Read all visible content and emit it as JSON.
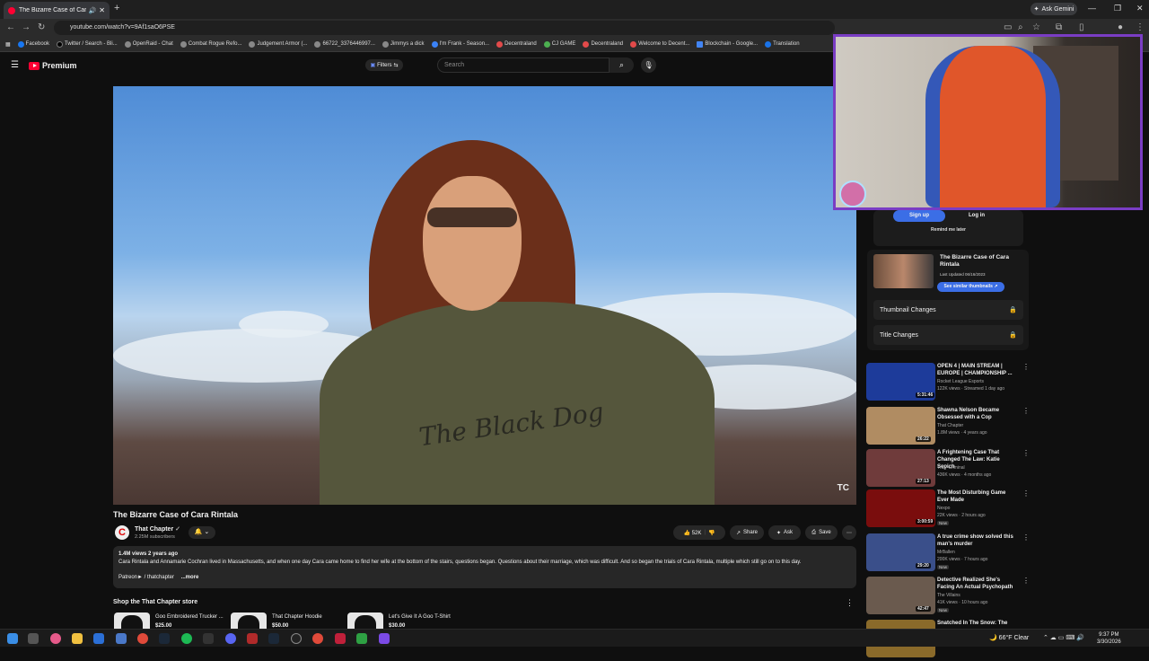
{
  "browser": {
    "tab_title": "The Bizarre Case of Cara Rintala",
    "new_tab": "+",
    "ask_gemini": "Ask Gemini",
    "url": "youtube.com/watch?v=9Af1saO6PSE",
    "bookmarks": [
      "Facebook",
      "Twitter / Search - Bli...",
      "OpenRaid - Chat",
      "Combat Rogue Refo...",
      "Judgement Armor (...",
      "66722_3376446997...",
      "Jimmys a dick",
      "I'm Frank - Season...",
      "Decentraland",
      "CJ GAME",
      "Decentraland",
      "Welcome to Decent...",
      "Blockchain - Google...",
      "Translation"
    ]
  },
  "youtube": {
    "logo_label": "Premium",
    "filters_label": "Filters",
    "search_placeholder": "Search"
  },
  "video": {
    "title": "The Bizarre Case of Cara Rintala",
    "hoodie_text": "The Black Dog",
    "watermark": "TC",
    "channel": {
      "avatar_letter": "C",
      "name": "That Chapter",
      "subscribers": "2.25M subscribers"
    },
    "likes": "52K",
    "share_label": "Share",
    "ask_label": "Ask",
    "save_label": "Save",
    "description": {
      "meta": "1.4M views  2 years ago",
      "text": "Cara Rintala and Annamarie Cochran lived in Massachusetts, and when one day Cara came home to find her wife at the bottom of the stairs, questions began. Questions about their marriage, which was difficult. And so began the trials of Cara Rintala, multiple which still go on to this day.",
      "links": "Patreon►  / thatchapter",
      "more": "...more"
    }
  },
  "store": {
    "title": "Shop the That Chapter store",
    "products": [
      {
        "name": "Goo Embroidered Trucker ...",
        "price": "$25.00"
      },
      {
        "name": "That Chapter Hoodie",
        "price": "$50.00"
      },
      {
        "name": "Let's Give It A Goo T-Shirt",
        "price": "$30.00"
      }
    ]
  },
  "sidebar": {
    "signup": "Sign up",
    "login": "Log in",
    "remind": "Remind me later",
    "thumb_card": {
      "title": "The Bizarre Case of Cara Rintala",
      "updated": "Last Updated 06/16/2023",
      "similar": "See similar thumbnails ↗"
    },
    "lock_rows": [
      "Thumbnail Changes",
      "Title Changes"
    ],
    "recommendations": [
      {
        "title": "OPEN 4 | MAIN STREAM | EUROPE | CHAMPIONSHIP ...",
        "channel": "Rocket League Esports",
        "stats": "122K views · Streamed 1 day ago",
        "duration": "5:31:46",
        "badge": "",
        "color": "#1d3b9a"
      },
      {
        "title": "Shawna Nelson Became Obsessed with a Cop",
        "channel": "That Chapter",
        "stats": "1.8M views · 4 years ago",
        "duration": "26:22",
        "badge": "",
        "color": "#b08c62"
      },
      {
        "title": "A Frightening Case That Changed The Law: Katie Sepich",
        "channel": "Truly Criminal",
        "stats": "436K views · 4 months ago",
        "duration": "27:13",
        "badge": "",
        "color": "#6f3b3b"
      },
      {
        "title": "The Most Disturbing Game Ever Made",
        "channel": "Nexpo",
        "stats": "22K views · 2 hours ago",
        "duration": "3:00:59",
        "badge": "New",
        "color": "#7a0d0d"
      },
      {
        "title": "A true crime show solved this man's murder",
        "channel": "MrBallen",
        "stats": "200K views · 7 hours ago",
        "duration": "29:20",
        "badge": "New",
        "color": "#3a4f8a"
      },
      {
        "title": "Detective Realized She's Facing An Actual Psychopath",
        "channel": "The Villains",
        "stats": "41K views · 10 hours ago",
        "duration": "42:47",
        "badge": "New",
        "color": "#6a5a4e"
      },
      {
        "title": "Snatched In The Snow: The",
        "channel": "",
        "stats": "",
        "duration": "",
        "badge": "",
        "color": "#8a6a2a"
      }
    ]
  },
  "taskbar": {
    "weather": "66°F  Clear",
    "time": "9:37 PM",
    "date": "3/30/2026"
  }
}
